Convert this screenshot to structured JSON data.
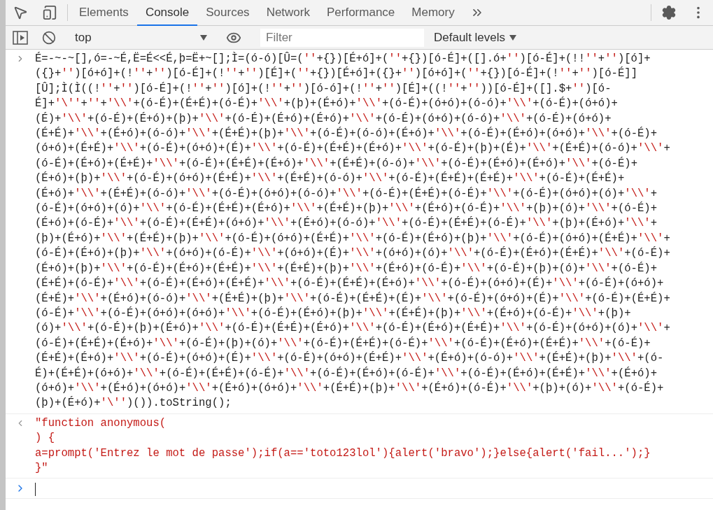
{
  "tabs": [
    {
      "label": "Elements",
      "selected": false
    },
    {
      "label": "Console",
      "selected": true
    },
    {
      "label": "Sources",
      "selected": false
    },
    {
      "label": "Network",
      "selected": false
    },
    {
      "label": "Performance",
      "selected": false
    },
    {
      "label": "Memory",
      "selected": false
    }
  ],
  "console_toolbar": {
    "context": "top",
    "filter_placeholder": "Filter",
    "levels": "Default levels"
  },
  "entries": [
    {
      "kind": "input",
      "lines": [
        "É=-~-~[],ó=-~É,Ë=É<<É,þ=Ë+~[];Ì=(ó-ó)[Û=(''+{})[É+ó]+(''+{})[ó-É]+([].ó+'')[ó-É]+(!!''+'')[ó]+",
        "({}+'')[ó+ó]+(!''+'')[ó-É]+(!''+'')[É]+(''+{})[É+ó]+({}+'')[ó+ó]+(''+{})[ó-É]+(!''+'')[ó-É]]",
        "[Û];Ì(Ì((!''+'')[ó-É]+(!''+'')[ó]+(!''+'')[ó-ó]+(!''+'')[É]+((!''+''))[ó-É]+([].$+'')[ó-",
        "É]+'\\''+''+'\\\\'+(ó-É)+(É+É)+(ó-É)+'\\\\'+(þ)+(É+ó)+'\\\\'+(ó-É)+(ó+ó)+(ó-ó)+'\\\\'+(ó-É)+(ó+ó)+",
        "(É)+'\\\\'+(ó-É)+(É+ó)+(þ)+'\\\\'+(ó-É)+(É+ó)+(É+ó)+'\\\\'+(ó-É)+(ó+ó)+(ó-ó)+'\\\\'+(ó-É)+(ó+ó)+",
        "(É+É)+'\\\\'+(É+ó)+(ó-ó)+'\\\\'+(É+É)+(þ)+'\\\\'+(ó-É)+(ó-ó)+(É+ó)+'\\\\'+(ó-É)+(É+ó)+(ó+ó)+'\\\\'+(ó-É)+",
        "(ó+ó)+(É+É)+'\\\\'+(ó-É)+(ó+ó)+(É)+'\\\\'+(ó-É)+(É+É)+(É+ó)+'\\\\'+(ó-É)+(þ)+(É)+'\\\\'+(É+É)+(ó-ó)+'\\\\'+",
        "(ó-É)+(É+ó)+(É+É)+'\\\\'+(ó-É)+(É+É)+(É+ó)+'\\\\'+(É+É)+(ó-ó)+'\\\\'+(ó-É)+(É+ó)+(É+ó)+'\\\\'+(ó-É)+",
        "(É+ó)+(þ)+'\\\\'+(ó-É)+(ó+ó)+(É+É)+'\\\\'+(É+É)+(ó-ó)+'\\\\'+(ó-É)+(É+É)+(É+É)+'\\\\'+(ó-É)+(É+É)+",
        "(É+ó)+'\\\\'+(É+É)+(ó-ó)+'\\\\'+(ó-É)+(ó+ó)+(ó-ó)+'\\\\'+(ó-É)+(É+É)+(ó-É)+'\\\\'+(ó-É)+(ó+ó)+(ó)+'\\\\'+",
        "(ó-É)+(ó+ó)+(ó)+'\\\\'+(ó-É)+(É+É)+(É+ó)+'\\\\'+(É+É)+(þ)+'\\\\'+(É+ó)+(ó-É)+'\\\\'+(þ)+(ó)+'\\\\'+(ó-É)+",
        "(É+ó)+(ó-É)+'\\\\'+(ó-É)+(É+É)+(ó+ó)+'\\\\'+(É+ó)+(ó-ó)+'\\\\'+(ó-É)+(É+É)+(ó-É)+'\\\\'+(þ)+(É+ó)+'\\\\'+",
        "(þ)+(É+ó)+'\\\\'+(É+É)+(þ)+'\\\\'+(ó-É)+(ó+ó)+(É+É)+'\\\\'+(ó-É)+(É+ó)+(þ)+'\\\\'+(ó-É)+(ó+ó)+(É+É)+'\\\\'+",
        "(ó-É)+(É+ó)+(þ)+'\\\\'+(ó+ó)+(ó-É)+'\\\\'+(ó+ó)+(É)+'\\\\'+(ó+ó)+(ó)+'\\\\'+(ó-É)+(É+ó)+(É+É)+'\\\\'+(ó-É)+",
        "(É+ó)+(þ)+'\\\\'+(ó-É)+(É+ó)+(É+É)+'\\\\'+(É+É)+(þ)+'\\\\'+(É+ó)+(ó-É)+'\\\\'+(ó-É)+(þ)+(ó)+'\\\\'+(ó-É)+",
        "(É+É)+(ó-É)+'\\\\'+(ó-É)+(É+ó)+(É+É)+'\\\\'+(ó-É)+(É+É)+(É+ó)+'\\\\'+(ó-É)+(ó+ó)+(É)+'\\\\'+(ó-É)+(ó+ó)+",
        "(É+É)+'\\\\'+(É+ó)+(ó-ó)+'\\\\'+(É+É)+(þ)+'\\\\'+(ó-É)+(É+É)+(É)+'\\\\'+(ó-É)+(ó+ó)+(É)+'\\\\'+(ó-É)+(É+É)+",
        "(ó-É)+'\\\\'+(ó-É)+(ó+ó)+(ó+ó)+'\\\\'+(ó-É)+(É+ó)+(þ)+'\\\\'+(É+É)+(þ)+'\\\\'+(É+ó)+(ó-É)+'\\\\'+(þ)+",
        "(ó)+'\\\\'+(ó-É)+(þ)+(É+ó)+'\\\\'+(ó-É)+(É+É)+(É+ó)+'\\\\'+(ó-É)+(É+ó)+(É+É)+'\\\\'+(ó-É)+(ó+ó)+(ó)+'\\\\'+",
        "(ó-É)+(É+É)+(É+ó)+'\\\\'+(ó-É)+(þ)+(ó)+'\\\\'+(ó-É)+(É+É)+(ó-É)+'\\\\'+(ó-É)+(É+ó)+(É+É)+'\\\\'+(ó-É)+",
        "(É+É)+(É+ó)+'\\\\'+(ó-É)+(ó+ó)+(É)+'\\\\'+(ó-É)+(ó+ó)+(É+É)+'\\\\'+(É+ó)+(ó-ó)+'\\\\'+(É+É)+(þ)+'\\\\'+(ó-",
        "É)+(É+É)+(ó+ó)+'\\\\'+(ó-É)+(É+É)+(ó-É)+'\\\\'+(ó-É)+(É+ó)+(ó-É)+'\\\\'+(ó-É)+(É+ó)+(É+É)+'\\\\'+(É+ó)+",
        "(ó+ó)+'\\\\'+(É+ó)+(ó+ó)+'\\\\'+(É+ó)+(ó+ó)+'\\\\'+(É+É)+(þ)+'\\\\'+(É+ó)+(ó-É)+'\\\\'+(þ)+(ó)+'\\\\'+(ó-É)+",
        "(þ)+(É+ó)+'\\'')()).toString();"
      ]
    },
    {
      "kind": "output",
      "lines": [
        "\"function anonymous(",
        ") {",
        "a=prompt('Entrez le mot de passe');if(a=='toto123lol'){alert('bravo');}else{alert('fail...');}",
        "}\""
      ]
    }
  ]
}
